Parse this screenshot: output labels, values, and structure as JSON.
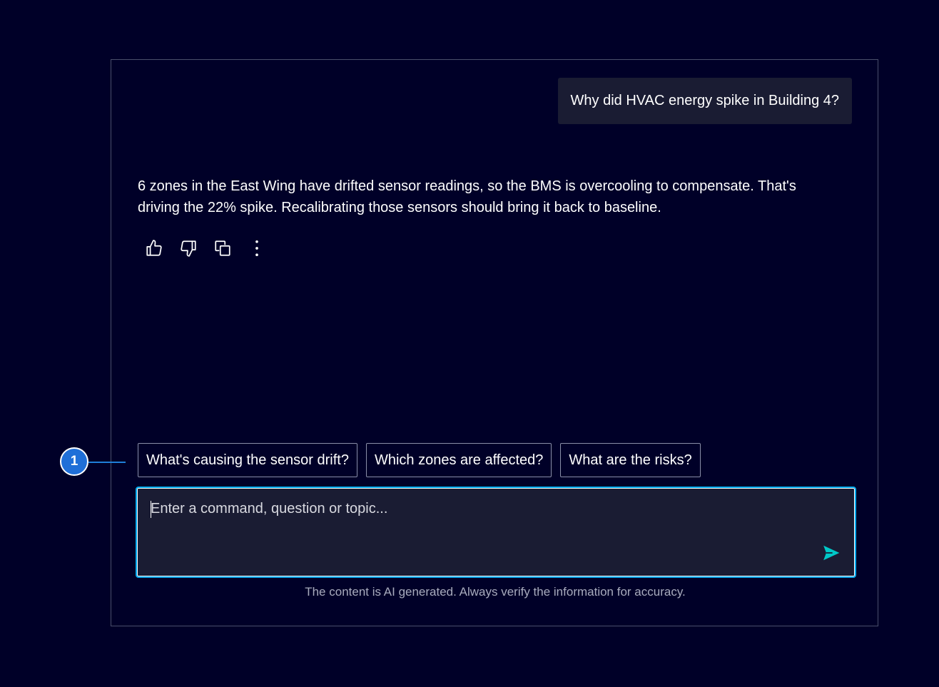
{
  "conversation": {
    "user_message": "Why did HVAC energy spike in Building 4?",
    "ai_response": "6 zones in the East Wing have drifted sensor readings, so the BMS is overcooling to compensate. That's driving the 22% spike. Recalibrating those sensors should bring it back to baseline."
  },
  "actions": [
    {
      "icon": "thumbs-up-icon"
    },
    {
      "icon": "thumbs-down-icon"
    },
    {
      "icon": "copy-icon"
    },
    {
      "icon": "more-vertical-icon"
    }
  ],
  "suggestions": [
    "What's causing the sensor drift?",
    "Which zones are affected?",
    "What are the risks?"
  ],
  "input": {
    "placeholder": "Enter a command, question or topic...",
    "value": ""
  },
  "disclaimer": "The content is AI generated. Always verify the information for accuracy.",
  "callout": {
    "number": "1"
  },
  "colors": {
    "background": "#000028",
    "focus_border": "#00aaf0",
    "send_accent": "#00c8c8",
    "callout": "#1f6fd8"
  }
}
